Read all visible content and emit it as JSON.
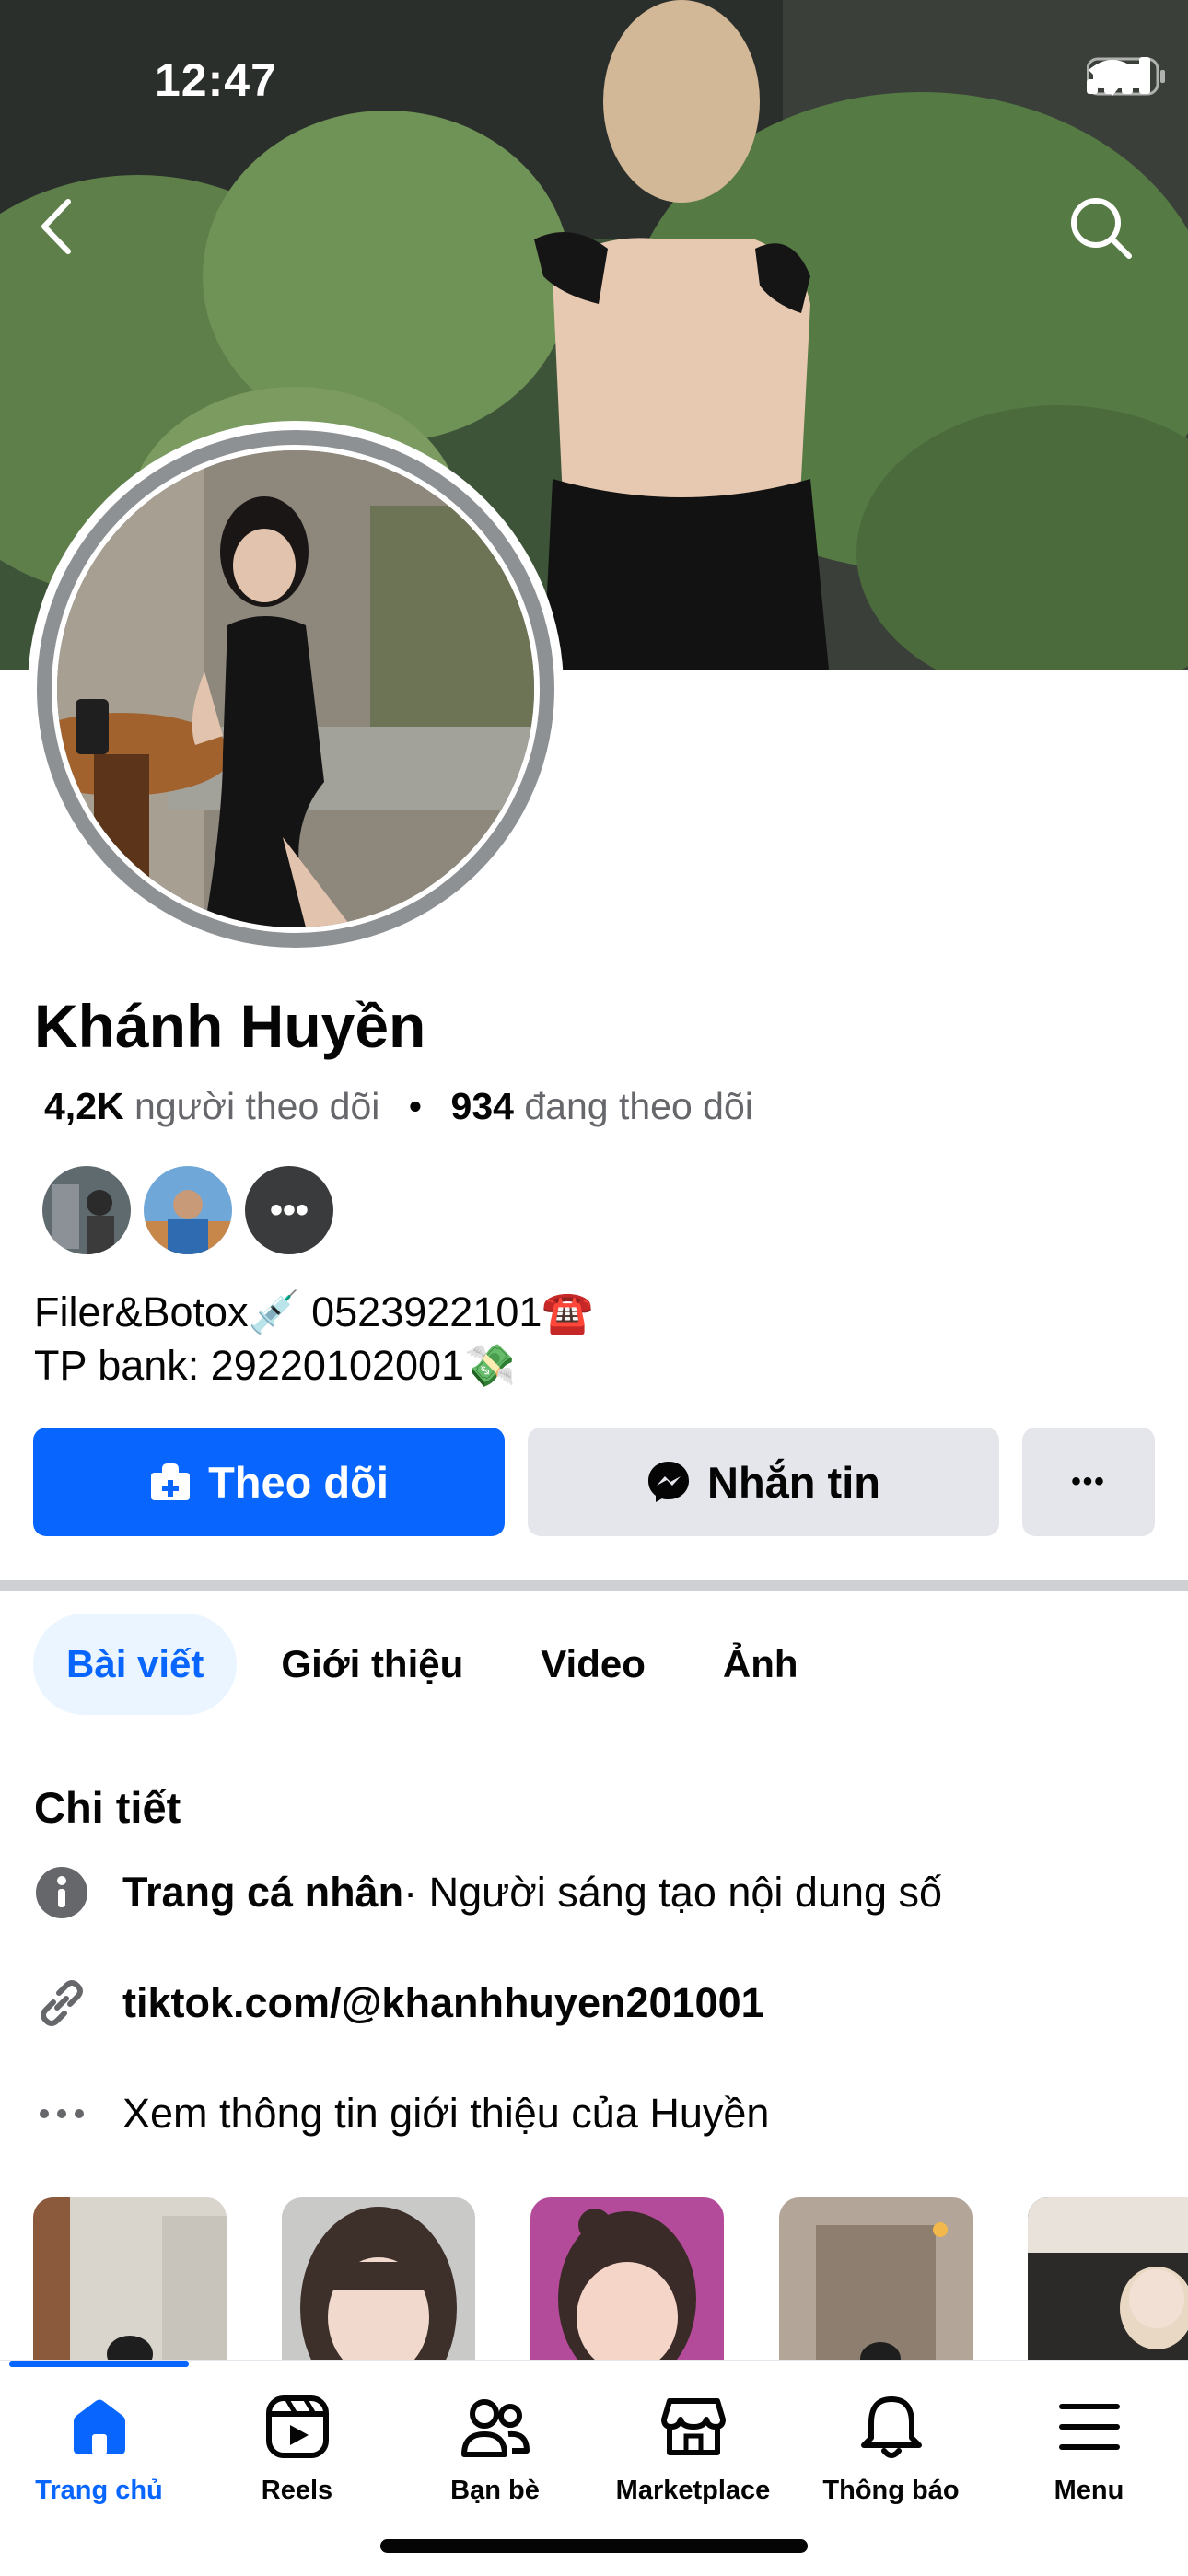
{
  "status_bar": {
    "time": "12:47"
  },
  "profile": {
    "name": "Khánh Huyền",
    "followers_count": "4,2K",
    "followers_label": "người theo dõi",
    "separator": "•",
    "following_count": "934",
    "following_label": "đang theo dõi",
    "friends_more": "•••",
    "bio_line1": "Filer&Botox💉 0523922101☎️",
    "bio_line2": "TP bank: 29220102001💸"
  },
  "actions": {
    "follow_label": "Theo dõi",
    "message_label": "Nhắn tin",
    "more_label": "•••"
  },
  "tabs": [
    {
      "label": "Bài viết",
      "active": true
    },
    {
      "label": "Giới thiệu",
      "active": false
    },
    {
      "label": "Video",
      "active": false
    },
    {
      "label": "Ảnh",
      "active": false
    }
  ],
  "details": {
    "title": "Chi tiết",
    "page_type_bold": "Trang cá nhân",
    "page_type_rest": " · Người sáng tạo nội dung số",
    "link": "tiktok.com/@khanhhuyen201001",
    "see_about": "Xem thông tin giới thiệu của Huyền"
  },
  "bottom_nav": [
    {
      "label": "Trang chủ",
      "icon": "home-icon",
      "active": true
    },
    {
      "label": "Reels",
      "icon": "reels-icon",
      "active": false
    },
    {
      "label": "Bạn bè",
      "icon": "friends-icon",
      "active": false
    },
    {
      "label": "Marketplace",
      "icon": "marketplace-icon",
      "active": false
    },
    {
      "label": "Thông báo",
      "icon": "bell-icon",
      "active": false
    },
    {
      "label": "Menu",
      "icon": "menu-icon",
      "active": false
    }
  ],
  "colors": {
    "accent": "#0866ff",
    "button_grey": "#e4e6eb",
    "secondary_text": "#65676b"
  }
}
